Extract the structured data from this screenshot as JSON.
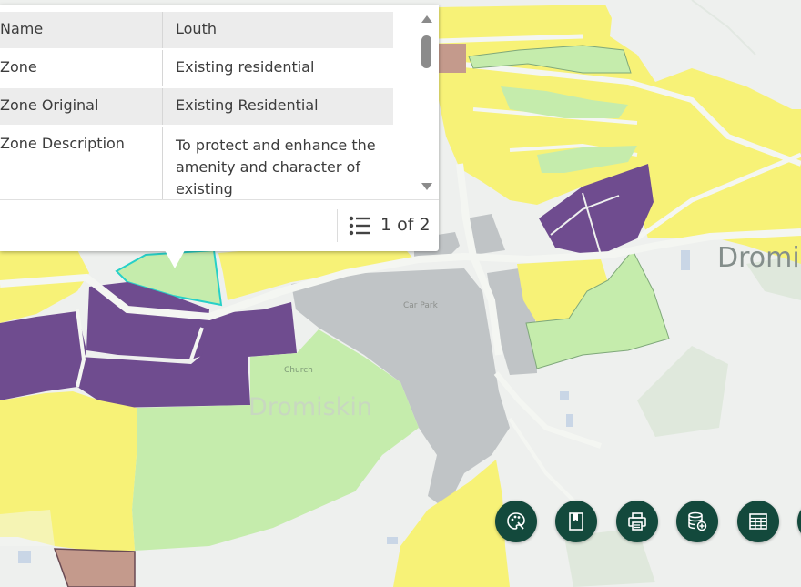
{
  "popup": {
    "rows": [
      {
        "key": "Name",
        "value": "Louth"
      },
      {
        "key": "Zone",
        "value": "Existing residential"
      },
      {
        "key": "Zone Original",
        "value": "Existing Residential"
      },
      {
        "key": "Zone Description",
        "value": "To protect and enhance the amenity and character of existing"
      }
    ],
    "pager": "1 of 2"
  },
  "map": {
    "labels": {
      "town": "Dromi",
      "village": "Dromiskin",
      "car_park": "Car Park",
      "church": "Church"
    },
    "colors": {
      "residential_yellow": "#f7f277",
      "open_space_green": "#c5ecac",
      "community_purple": "#6f4c8f",
      "town_centre_grey": "#c0c4c6",
      "other_brown": "#c49a8c",
      "background": "#eef0ee"
    }
  },
  "toolbar": {
    "buttons": [
      {
        "name": "basemap",
        "icon": "palette-icon"
      },
      {
        "name": "bookmarks",
        "icon": "bookmark-icon"
      },
      {
        "name": "print",
        "icon": "printer-icon"
      },
      {
        "name": "add-data",
        "icon": "database-add-icon"
      },
      {
        "name": "attribute-table",
        "icon": "table-icon"
      }
    ]
  }
}
